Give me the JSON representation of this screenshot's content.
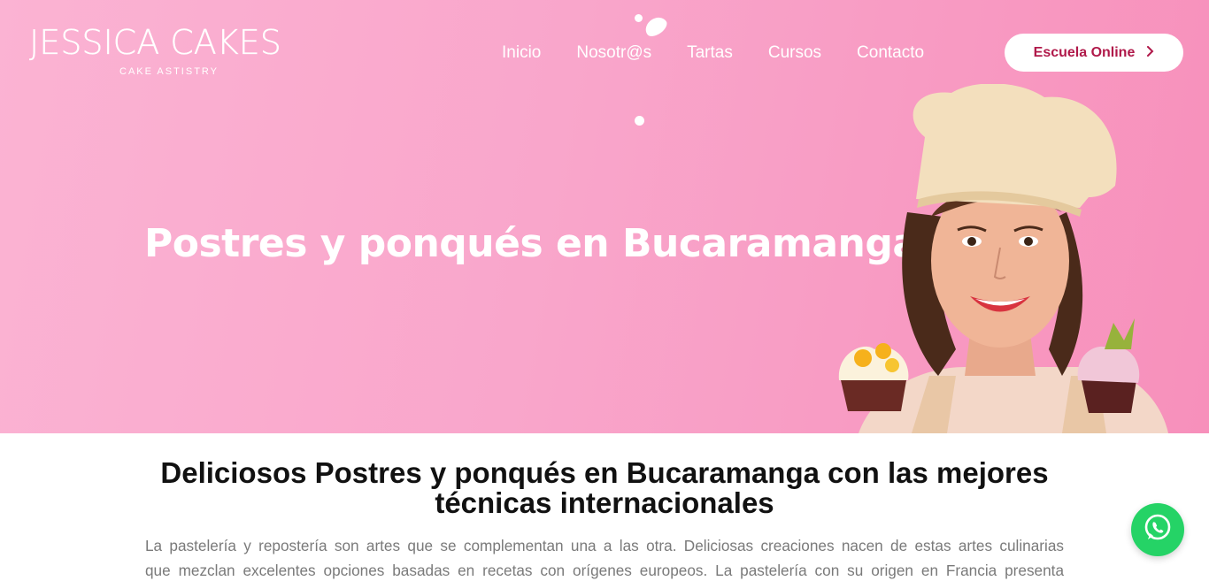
{
  "brand": {
    "name": "JESSICA CAKES",
    "tagline": "CAKE ASTISTRY"
  },
  "nav": {
    "items": [
      {
        "label": "Inicio"
      },
      {
        "label": "Nosotr@s"
      },
      {
        "label": "Tartas"
      },
      {
        "label": "Cursos"
      },
      {
        "label": "Contacto"
      }
    ],
    "cta_label": "Escuela Online",
    "cta_icon": "chevron-right-icon"
  },
  "hero": {
    "title": "Postres y ponqués en Bucaramanga",
    "image": "chef-woman-with-cupcakes"
  },
  "content": {
    "heading": "Deliciosos Postres y ponqués en Bucaramanga con las mejores técnicas internacionales",
    "body_line_1": "La pastelería y repostería son artes que se complementan una a las otra. Deliciosas creaciones nacen de estas artes culinarias",
    "body_line_2": "que mezclan excelentes opciones basadas en recetas con orígenes europeos. La pastelería con su origen en Francia presenta"
  },
  "floating": {
    "whatsapp_icon": "whatsapp-icon"
  },
  "colors": {
    "hero_pink": "#f9a6cb",
    "accent": "#b0194a",
    "whatsapp": "#25d366"
  }
}
